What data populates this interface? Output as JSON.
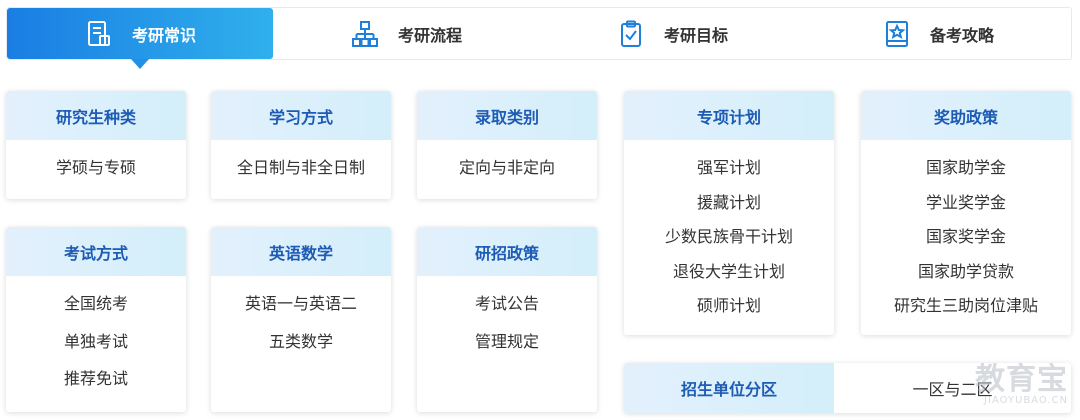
{
  "tabs": [
    {
      "label": "考研常识",
      "icon": "document-icon",
      "active": true
    },
    {
      "label": "考研流程",
      "icon": "org-chart-icon",
      "active": false
    },
    {
      "label": "考研目标",
      "icon": "clipboard-check-icon",
      "active": false
    },
    {
      "label": "备考攻略",
      "icon": "book-star-icon",
      "active": false
    }
  ],
  "cards": {
    "c1": {
      "title": "研究生种类",
      "items": [
        "学硕与专硕"
      ]
    },
    "c2": {
      "title": "学习方式",
      "items": [
        "全日制与非全日制"
      ]
    },
    "c3": {
      "title": "录取类别",
      "items": [
        "定向与非定向"
      ]
    },
    "c4": {
      "title": "专项计划",
      "items": [
        "强军计划",
        "援藏计划",
        "少数民族骨干计划",
        "退役大学生计划",
        "硕师计划"
      ]
    },
    "c5": {
      "title": "奖助政策",
      "items": [
        "国家助学金",
        "学业奖学金",
        "国家奖学金",
        "国家助学贷款",
        "研究生三助岗位津贴"
      ]
    },
    "c6": {
      "title": "考试方式",
      "items": [
        "全国统考",
        "单独考试",
        "推荐免试"
      ]
    },
    "c7": {
      "title": "英语数学",
      "items": [
        "英语一与英语二",
        "五类数学"
      ]
    },
    "c8": {
      "title": "研招政策",
      "items": [
        "考试公告",
        "管理规定"
      ]
    }
  },
  "split_card": {
    "title": "招生单位分区",
    "value": "一区与二区"
  },
  "watermark": {
    "cn": "教育宝",
    "en": "JIAOYUBAO.CN"
  },
  "colors": {
    "accent_start": "#1a7de3",
    "accent_end": "#2fb0ec",
    "card_title": "#1d5bb5",
    "card_header_bg": "#e3f0fc"
  }
}
